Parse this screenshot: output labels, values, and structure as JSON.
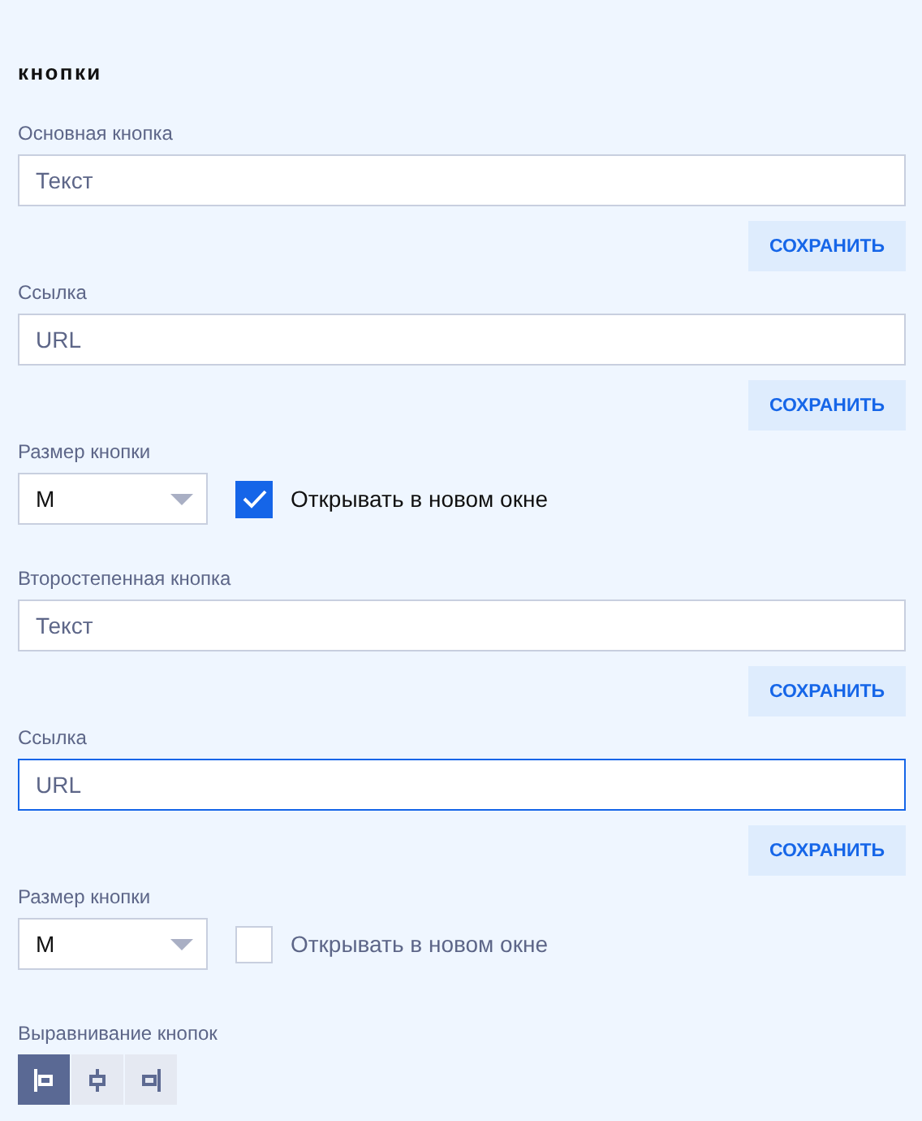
{
  "heading": "кнопки",
  "groups": [
    {
      "text_field": {
        "label": "Основная кнопка",
        "placeholder": "Текст",
        "focused": false
      },
      "text_save": "СОХРАНИТЬ",
      "link_field": {
        "label": "Ссылка",
        "placeholder": "URL",
        "focused": false
      },
      "link_save": "СОХРАНИТЬ",
      "size": {
        "label": "Размер кнопки",
        "value": "M"
      },
      "new_window": {
        "label": "Открывать в новом окне",
        "checked": true
      }
    },
    {
      "text_field": {
        "label": "Второстепенная кнопка",
        "placeholder": "Текст",
        "focused": false
      },
      "text_save": "СОХРАНИТЬ",
      "link_field": {
        "label": "Ссылка",
        "placeholder": "URL",
        "focused": true
      },
      "link_save": "СОХРАНИТЬ",
      "size": {
        "label": "Размер кнопки",
        "value": "M"
      },
      "new_window": {
        "label": "Открывать в новом окне",
        "checked": false
      }
    }
  ],
  "alignment": {
    "label": "Выравнивание кнопок",
    "options": [
      {
        "kind": "left",
        "selected": true
      },
      {
        "kind": "center",
        "selected": false
      },
      {
        "kind": "right",
        "selected": false
      }
    ]
  }
}
